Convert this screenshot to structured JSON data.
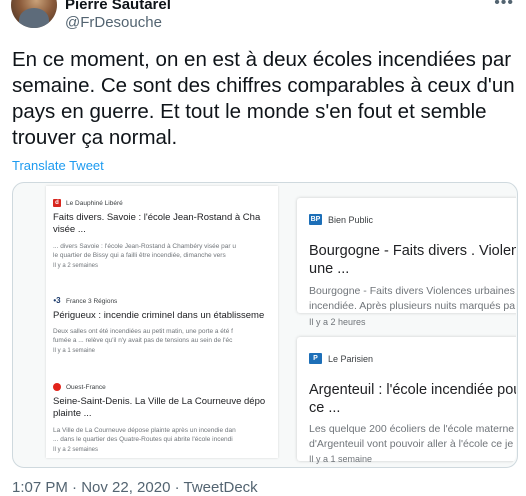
{
  "author": {
    "name": "Pierre Sautarel",
    "handle": "@FrDesouche"
  },
  "more_label": "•••",
  "tweet_text": "En ce moment, on en est à deux écoles incendiées par semaine. Ce sont des chiffres comparables à ceux d'un pays en guerre. Et tout le monde s'en fout et semble trouver ça normal.",
  "translate_label": "Translate Tweet",
  "left_cards": [
    {
      "source": "Le Dauphiné Libéré",
      "icon": "dauphine-icon",
      "color": "#d7261e",
      "title1": "Faits divers. Savoie : l'école Jean-Rostand à Cha",
      "title2": "visée ...",
      "desc1": "... divers Savoie : l'école Jean-Rostand à Chambéry visée par u",
      "desc2": "le quartier de Bissy qui a failli être incendiée, dimanche vers",
      "time": "Il y a 2 semaines"
    },
    {
      "source": "France 3 Régions",
      "icon": "france3-icon",
      "color": "#1b3a6b",
      "title1": "Périgueux : incendie criminel dans un établisseme",
      "title2": "",
      "desc1": "Deux salles ont été incendiées au petit matin, une porte a été f",
      "desc2": "fumée a ... relève qu'il n'y avait pas de tensions au sein de l'éc",
      "time": "Il y a 1 semaine"
    },
    {
      "source": "Ouest-France",
      "icon": "ouest-france-icon",
      "color": "#e2231a",
      "title1": "Seine-Saint-Denis. La Ville de La Courneuve dépo",
      "title2": "plainte ...",
      "desc1": "La Ville de La Courneuve dépose plainte après un incendie dan",
      "desc2": "... dans le quartier des Quatre-Routes qui abrite l'école incendi",
      "time": "Il y a 2 semaines"
    }
  ],
  "right_cards": [
    {
      "source": "Bien Public",
      "icon": "bien-public-icon",
      "color": "#1d6fb8",
      "icon_text": "BP",
      "title1": "Bourgogne - Faits divers . Violenc",
      "title2": "une ...",
      "desc1": "Bourgogne - Faits divers Violences urbaines",
      "desc2": "incendiée. Après plusieurs nuits marqués pa",
      "time": "Il y a 2 heures"
    },
    {
      "source": "Le Parisien",
      "icon": "le-parisien-icon",
      "color": "#1d6fb8",
      "icon_text": "P",
      "title1": "Argenteuil : l'école incendiée pour",
      "title2": "ce ...",
      "desc1": "Les quelque 200 écoliers de l'école materne",
      "desc2": "d'Argenteuil vont pouvoir aller à l'école ce je",
      "time": "Il y a 1 semaine"
    }
  ],
  "footer": "1:07 PM · Nov 22, 2020 · TweetDeck"
}
